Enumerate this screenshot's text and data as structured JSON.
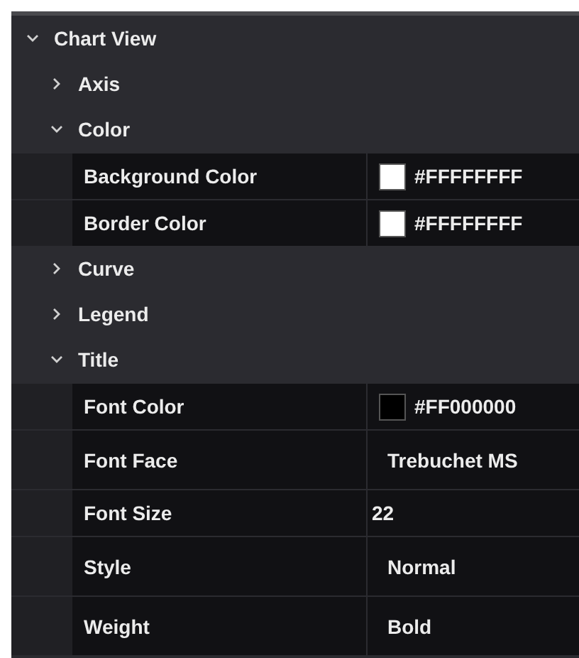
{
  "tree": {
    "label": "Chart View",
    "expanded": true,
    "children": [
      {
        "label": "Axis",
        "expanded": false
      },
      {
        "label": "Color",
        "expanded": true,
        "properties": [
          {
            "name": "Background Color",
            "kind": "color",
            "value": "#FFFFFFFF",
            "color": "#ffffff"
          },
          {
            "name": "Border Color",
            "kind": "color",
            "value": "#FFFFFFFF",
            "color": "#ffffff"
          }
        ]
      },
      {
        "label": "Curve",
        "expanded": false
      },
      {
        "label": "Legend",
        "expanded": false
      },
      {
        "label": "Title",
        "expanded": true,
        "properties": [
          {
            "name": "Font Color",
            "kind": "color",
            "value": "#FF000000",
            "color": "#000000"
          },
          {
            "name": "Font Face",
            "kind": "dropdown",
            "value": "Trebuchet MS"
          },
          {
            "name": "Font Size",
            "kind": "text",
            "value": "22"
          },
          {
            "name": "Style",
            "kind": "dropdown",
            "value": "Normal"
          },
          {
            "name": "Weight",
            "kind": "dropdown",
            "value": "Bold"
          }
        ]
      }
    ]
  }
}
